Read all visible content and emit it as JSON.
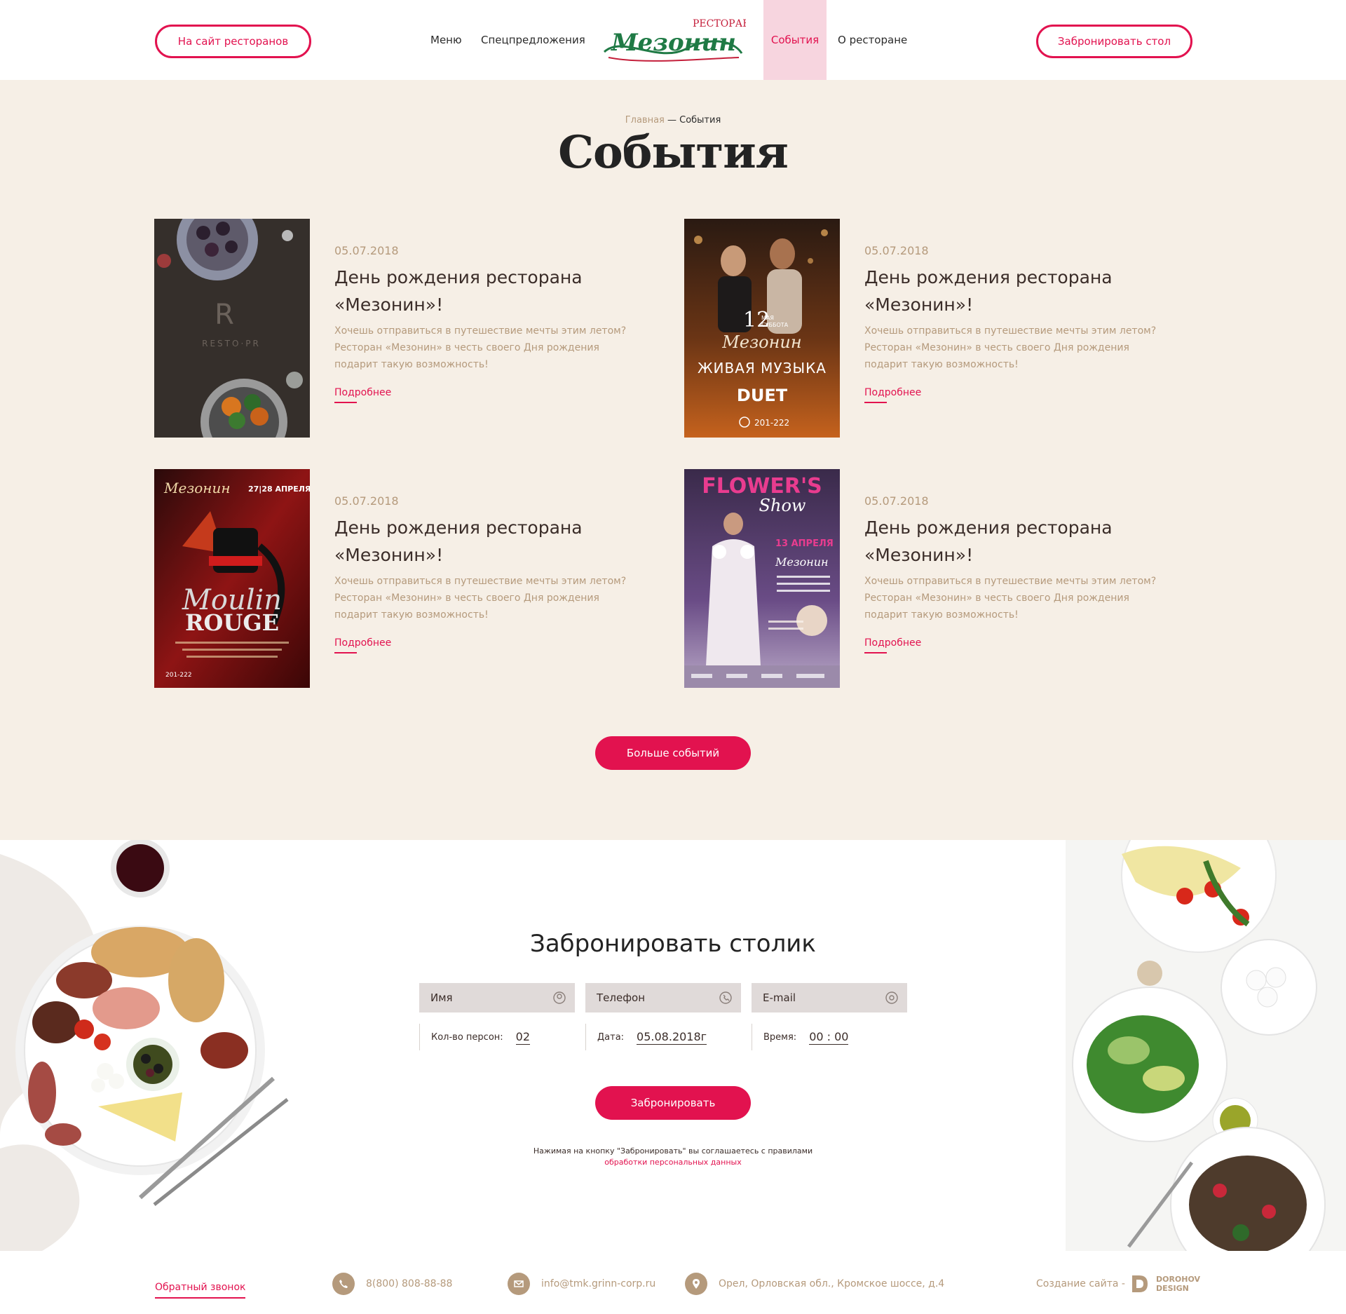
{
  "header": {
    "sites_button": "На сайт ресторанов",
    "book_button": "Забронировать стол",
    "nav": [
      "Меню",
      "Спецпредложения",
      "События",
      "О ресторане"
    ],
    "logo_top": "РЕСТОРАН",
    "logo_main": "Мезонин"
  },
  "events": {
    "breadcrumb_home": "Главная",
    "breadcrumb_sep": " — ",
    "breadcrumb_current": "События",
    "title": "События",
    "items": [
      {
        "date": "05.07.2018",
        "title": "День рождения ресторана «Мезонин»!",
        "desc": "Хочешь отправиться в путешествие мечты этим летом? Ресторан «Мезонин» в честь своего Дня рождения подарит такую возможность!",
        "more": "Подробнее"
      },
      {
        "date": "05.07.2018",
        "title": "День рождения ресторана «Мезонин»!",
        "desc": "Хочешь отправиться в путешествие мечты этим летом? Ресторан «Мезонин» в честь своего Дня рождения подарит такую возможность!",
        "more": "Подробнее"
      },
      {
        "date": "05.07.2018",
        "title": "День рождения ресторана «Мезонин»!",
        "desc": "Хочешь отправиться в путешествие мечты этим летом? Ресторан «Мезонин» в честь своего Дня рождения подарит такую возможность!",
        "more": "Подробнее"
      },
      {
        "date": "05.07.2018",
        "title": "День рождения ресторана «Мезонин»!",
        "desc": "Хочешь отправиться в путешествие мечты этим летом? Ресторан «Мезонин» в честь своего Дня рождения подарит такую возможность!",
        "more": "Подробнее"
      }
    ],
    "posters": {
      "resto": "RESTO·PR",
      "music_day": "12",
      "music_month": "МАЯ",
      "music_weekday": "СУББОТА",
      "music_title": "ЖИВАЯ МУЗЫКА",
      "music_band": "DUET",
      "music_phone": "201-222",
      "moulin_dates": "27|28 АПРЕЛЯ",
      "moulin_word1": "Moulin",
      "moulin_word2": "ROUGE",
      "moulin_phone": "201-222",
      "flower_title": "FLOWER'S",
      "flower_sub": "Show",
      "flower_date": "13 АПРЕЛЯ",
      "flower_text": "ШОУ-ПОКАЗ БУДУЩИХ ФЛОРИСТОВ ПОДАРКИ ОТ СПОНСОРОВ"
    },
    "more_button": "Больше событий"
  },
  "booking": {
    "title": "Забронировать столик",
    "name_placeholder": "Имя",
    "phone_placeholder": "Телефон",
    "email_placeholder": "E-mail",
    "persons_label": "Кол-во персон:",
    "persons_value": "02",
    "date_label": "Дата:",
    "date_value": "05.08.2018г",
    "time_label": "Время:",
    "time_value": "00 : 00",
    "submit": "Забронировать",
    "consent_text": "Нажимая на кнопку \"Забронировать\" вы соглашаетесь с правилами",
    "consent_link": "обработки персональных данных"
  },
  "footer": {
    "callback": "Обратный звонок",
    "phone": "8(800) 808-88-88",
    "email": "info@tmk.grinn-corp.ru",
    "address": "Орел, Орловская обл., Кромское шоссе, д.4",
    "credit": "Создание сайта -",
    "credit_name_1": "DOROHOV",
    "credit_name_2": "DESIGN"
  },
  "colors": {
    "accent": "#e2124f",
    "beige_bg": "#f6efe6",
    "muted_text": "#b59a7c",
    "nav_active_bg": "#f7d5df"
  }
}
